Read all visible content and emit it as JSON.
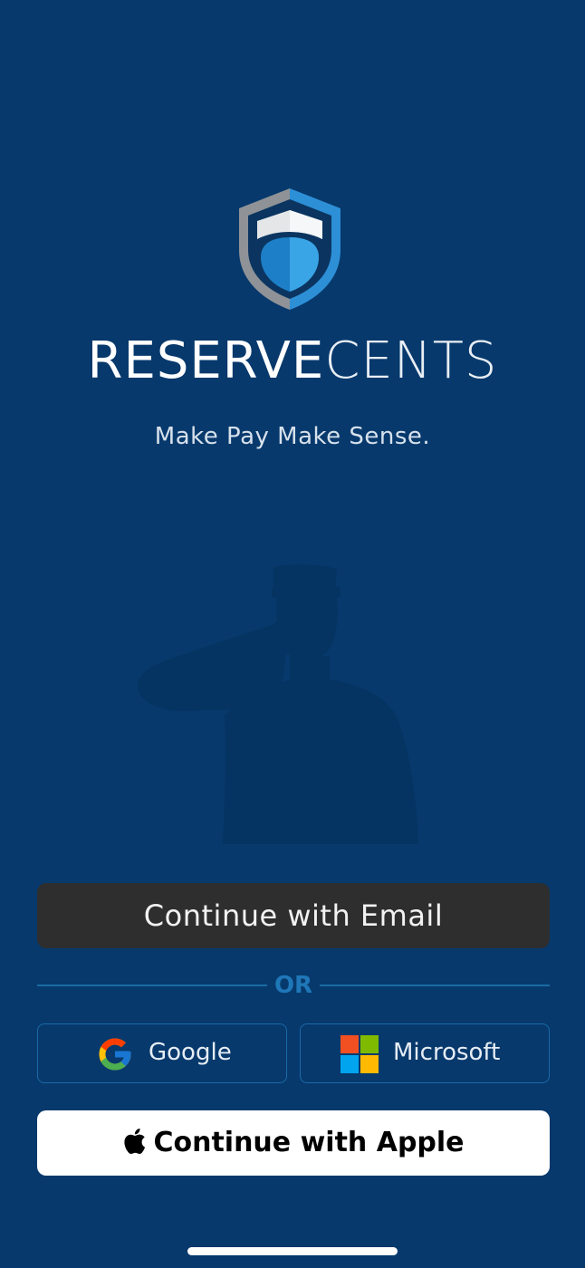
{
  "brand": {
    "name_bold": "RESERVE",
    "name_light": "CENTS",
    "tagline": "Make Pay Make Sense."
  },
  "auth": {
    "email_button": "Continue with Email",
    "divider_text": "OR",
    "google_button": "Google",
    "microsoft_button": "Microsoft",
    "apple_button": "Continue with Apple"
  },
  "icons": {
    "logo": "shield-logo",
    "google": "google-g-icon",
    "microsoft": "microsoft-squares-icon",
    "apple": "apple-icon",
    "illustration": "saluting-soldier-silhouette"
  },
  "colors": {
    "background": "#07396c",
    "email_button_bg": "#2e2e2f",
    "accent_line": "#1a6aa6",
    "apple_button_bg": "#ffffff"
  }
}
